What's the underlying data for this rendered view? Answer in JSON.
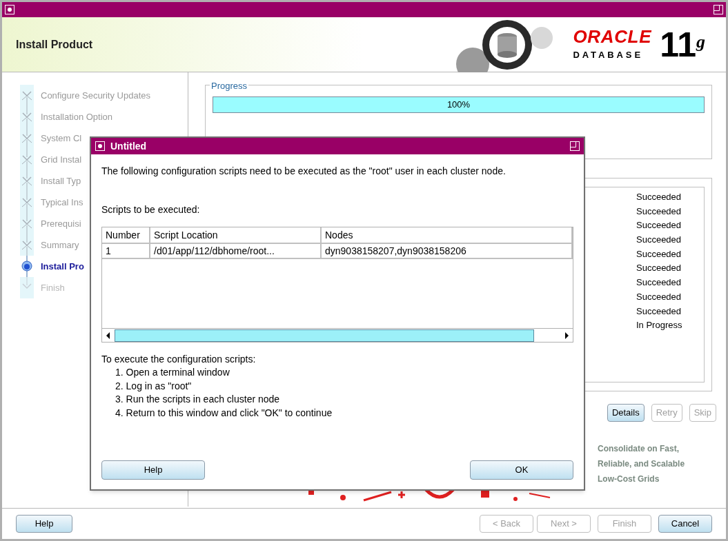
{
  "window": {
    "title": "Install Product"
  },
  "logo": {
    "brand": "ORACLE",
    "product": "DATABASE",
    "version": "11",
    "version_suffix": "g"
  },
  "steps": [
    {
      "label": "Configure Security Updates",
      "kind": "done"
    },
    {
      "label": "Installation Option",
      "kind": "done"
    },
    {
      "label": "System Cl",
      "kind": "done"
    },
    {
      "label": "Grid Instal",
      "kind": "done"
    },
    {
      "label": "Install Typ",
      "kind": "done"
    },
    {
      "label": "Typical Ins",
      "kind": "done"
    },
    {
      "label": "Prerequisi",
      "kind": "done"
    },
    {
      "label": "Summary",
      "kind": "done"
    },
    {
      "label": "Install Pro",
      "kind": "current"
    },
    {
      "label": "Finish",
      "kind": "pending"
    }
  ],
  "progress": {
    "legend": "Progress",
    "level": 1,
    "reading": "100%"
  },
  "status_list": [
    "Succeeded",
    "Succeeded",
    "Succeeded",
    "Succeeded",
    "Succeeded",
    "Succeeded",
    "Succeeded",
    "Succeeded",
    "Succeeded",
    "In Progress"
  ],
  "task_buttons": [
    {
      "label": "Details",
      "disabled": false
    },
    {
      "label": "Retry",
      "disabled": true
    },
    {
      "label": "Skip",
      "disabled": true
    }
  ],
  "tagline": [
    "Consolidate on Fast,",
    "Reliable, and Scalable",
    "Low-Cost Grids"
  ],
  "footer": {
    "help": {
      "label": "Help",
      "disabled": false
    },
    "nav": [
      {
        "label": "< Back",
        "disabled": true
      },
      {
        "label": "Next >",
        "disabled": true
      },
      {
        "label": "Finish",
        "disabled": true
      },
      {
        "label": "Cancel",
        "disabled": false
      }
    ]
  },
  "dialog": {
    "title": "Untitled",
    "message": "The following configuration scripts need to be executed as the \"root\" user in each cluster node.",
    "scripts_label": "Scripts to be executed:",
    "table": {
      "columns": [
        "Number",
        "Script Location",
        "Nodes"
      ],
      "rows": [
        [
          "1",
          "/d01/app/112/dbhome/root...",
          "dyn9038158207,dyn9038158206"
        ]
      ]
    },
    "instructions_title": "To execute the configuration scripts:",
    "instructions": [
      "1. Open a terminal window",
      "2. Log in as \"root\"",
      "3. Run the scripts in each cluster node",
      "4. Return to this window and click \"OK\" to continue"
    ],
    "help": {
      "label": "Help",
      "disabled": false
    },
    "ok": {
      "label": "OK",
      "disabled": false
    }
  }
}
